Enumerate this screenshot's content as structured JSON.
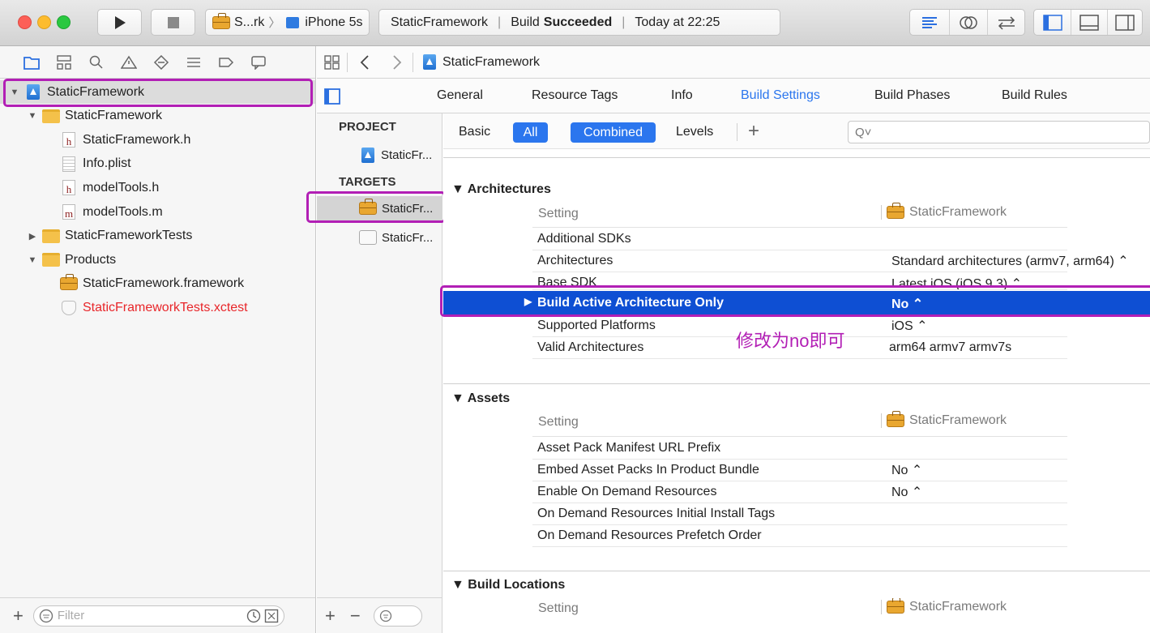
{
  "toolbar": {
    "scheme_name": "S...rk",
    "device_name": "iPhone 5s",
    "activity": {
      "project": "StaticFramework",
      "status_prefix": "Build",
      "status_strong": "Succeeded",
      "time": "Today at 22:25"
    }
  },
  "navigator": {
    "tree": [
      {
        "label": "StaticFramework",
        "icon": "project-icon",
        "level": 0,
        "disclosure": "open",
        "selected": true
      },
      {
        "label": "StaticFramework",
        "icon": "folder-icon",
        "level": 1,
        "disclosure": "open"
      },
      {
        "label": "StaticFramework.h",
        "icon": "header-file-icon",
        "glyph": "h",
        "level": 2
      },
      {
        "label": "Info.plist",
        "icon": "plist-file-icon",
        "level": 2
      },
      {
        "label": "modelTools.h",
        "icon": "header-file-icon",
        "glyph": "h",
        "level": 2
      },
      {
        "label": "modelTools.m",
        "icon": "implementation-file-icon",
        "glyph": "m",
        "level": 2
      },
      {
        "label": "StaticFrameworkTests",
        "icon": "folder-icon",
        "level": 1,
        "disclosure": "closed"
      },
      {
        "label": "Products",
        "icon": "folder-icon",
        "level": 1,
        "disclosure": "open"
      },
      {
        "label": "StaticFramework.framework",
        "icon": "framework-icon",
        "level": 2
      },
      {
        "label": "StaticFrameworkTests.xctest",
        "icon": "xctest-icon",
        "level": 2,
        "color": "#e8262a"
      }
    ],
    "filter_placeholder": "Filter"
  },
  "jumpbar": {
    "crumb": "StaticFramework"
  },
  "tabs": [
    "General",
    "Resource Tags",
    "Info",
    "Build Settings",
    "Build Phases",
    "Build Rules"
  ],
  "active_tab": "Build Settings",
  "project_panel": {
    "project_header": "PROJECT",
    "project_item": "StaticFr...",
    "targets_header": "TARGETS",
    "targets": [
      "StaticFr...",
      "StaticFr..."
    ]
  },
  "filter": {
    "basic": "Basic",
    "all": "All",
    "combined": "Combined",
    "levels": "Levels",
    "add": "+",
    "search_placeholder": "Q˅"
  },
  "sections": [
    {
      "title": "Architectures",
      "column_setting": "Setting",
      "column_target": "StaticFramework",
      "rows": [
        {
          "name": "Additional SDKs",
          "value": ""
        },
        {
          "name": "Architectures",
          "value": "Standard architectures (armv7, arm64) ⌃"
        },
        {
          "name": "Base SDK",
          "value": "Latest iOS (iOS 9.3) ⌃"
        },
        {
          "name": "Build Active Architecture Only",
          "value": "No ⌃",
          "selected": true
        },
        {
          "name": "Supported Platforms",
          "value": "iOS ⌃"
        },
        {
          "name": "Valid Architectures",
          "value": "arm64 armv7 armv7s"
        }
      ]
    },
    {
      "title": "Assets",
      "column_setting": "Setting",
      "column_target": "StaticFramework",
      "rows": [
        {
          "name": "Asset Pack Manifest URL Prefix",
          "value": ""
        },
        {
          "name": "Embed Asset Packs In Product Bundle",
          "value": "No ⌃"
        },
        {
          "name": "Enable On Demand Resources",
          "value": "No ⌃"
        },
        {
          "name": "On Demand Resources Initial Install Tags",
          "value": ""
        },
        {
          "name": "On Demand Resources Prefetch Order",
          "value": ""
        }
      ]
    },
    {
      "title": "Build Locations",
      "column_setting": "Setting",
      "column_target": "StaticFramework",
      "rows": []
    }
  ],
  "annotation": "修改为no即可",
  "colors": {
    "accent": "#2b76ee",
    "selection": "#0e4fd3",
    "highlight": "#b21fb5",
    "error_text": "#e8262a"
  }
}
